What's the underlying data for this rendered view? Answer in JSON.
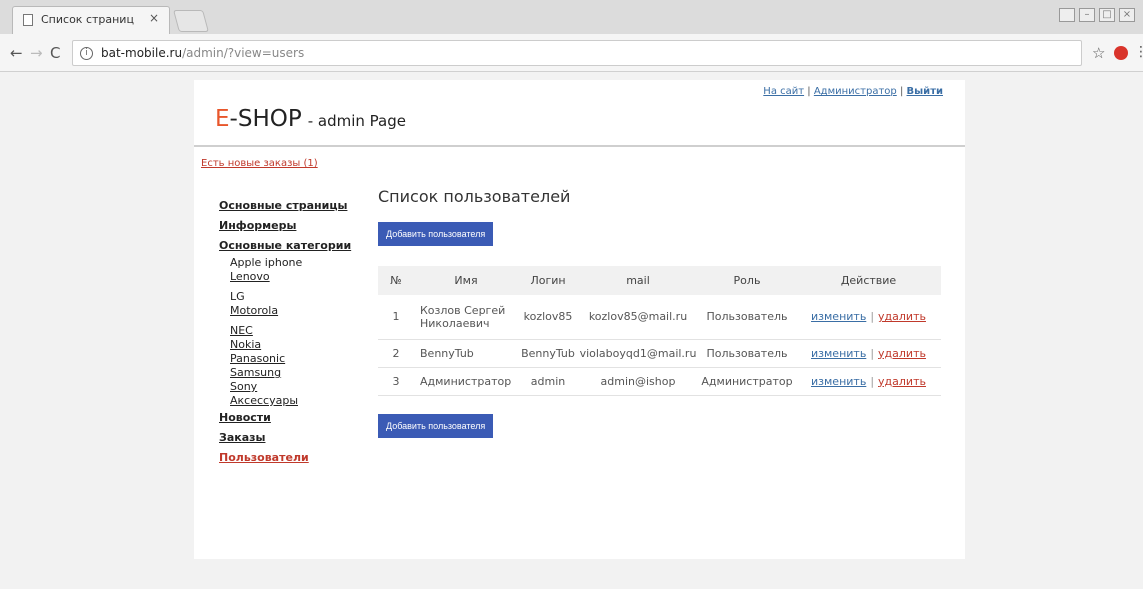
{
  "browser": {
    "tab_title": "Список страниц",
    "tab_close": "×",
    "url_host": "bat-mobile.ru",
    "url_path": "/admin/?view=users",
    "info_glyph": "i"
  },
  "header": {
    "logo_e": "E",
    "logo_shop": "-SHOP",
    "logo_sub": "- admin Page",
    "link_site": "На сайт",
    "link_admin": "Администратор",
    "link_logout": "Выйти",
    "separator": "|"
  },
  "notice": "Есть новые заказы (1)",
  "sidebar": {
    "main_pages": "Основные страницы",
    "informers": "Информеры",
    "categories": "Основные категории",
    "subcategories": [
      "Apple iphone",
      "Lenovo",
      "LG",
      "Motorola",
      "NEC",
      "Nokia",
      "Panasonic",
      "Samsung",
      "Sony",
      "Аксессуары"
    ],
    "news": "Новости",
    "orders": "Заказы",
    "users": "Пользователи"
  },
  "main": {
    "title": "Список пользователей",
    "add_button": "Добавить пользователя",
    "columns": [
      "№",
      "Имя",
      "Логин",
      "mail",
      "Роль",
      "Действие"
    ],
    "rows": [
      {
        "num": "1",
        "name": "Козлов Сергей Николаевич",
        "login": "kozlov85",
        "mail": "kozlov85@mail.ru",
        "role": "Пользователь",
        "edit": "изменить",
        "delete": "удалить"
      },
      {
        "num": "2",
        "name": "BennyTub",
        "login": "BennyTub",
        "mail": "violaboyqd1@mail.ru",
        "role": "Пользователь",
        "edit": "изменить",
        "delete": "удалить"
      },
      {
        "num": "3",
        "name": "Администратор",
        "login": "admin",
        "mail": "admin@ishop",
        "role": "Администратор",
        "edit": "изменить",
        "delete": "удалить"
      }
    ]
  },
  "colors": {
    "accent": "#e8562b",
    "button": "#3b5bb5",
    "danger": "#c0392b",
    "link": "#3a6ea5"
  }
}
